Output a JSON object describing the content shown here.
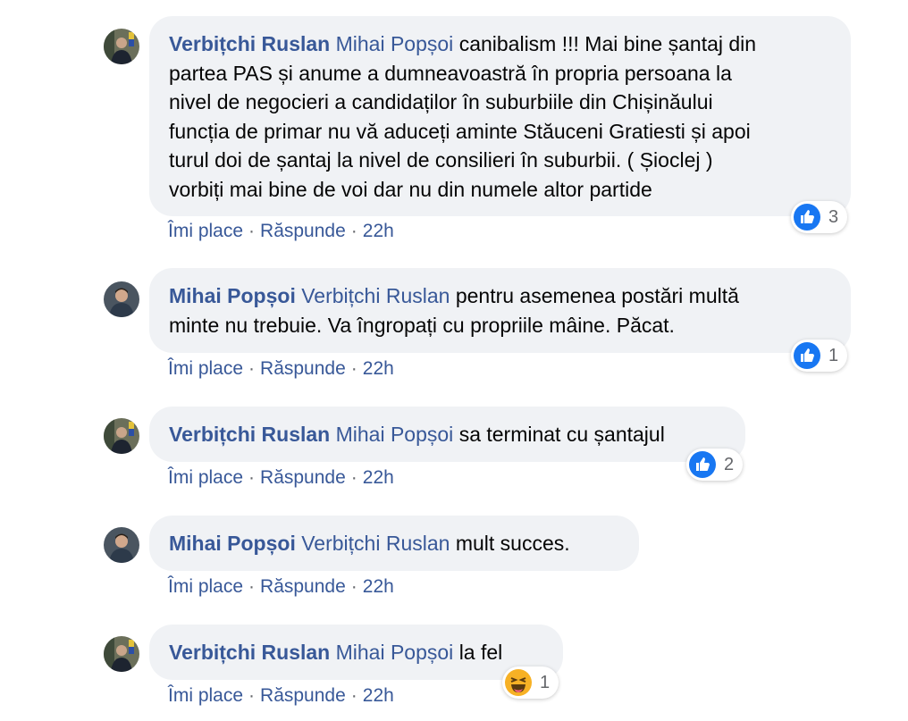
{
  "colors": {
    "link": "#385898",
    "bubble": "#f0f2f5",
    "like": "#1877f2",
    "haha": "#f7b125"
  },
  "actions": {
    "like": "Îmi place",
    "reply": "Răspunde",
    "dot": "·"
  },
  "comments": [
    {
      "author": "Verbițchi Ruslan",
      "mention": "Mihai Popșoi",
      "lines": [
        "canibalism !!! Mai bine șantaj din",
        "partea PAS și anume a dumneavoastră în propria persoana la",
        "nivel de negocieri a candidaților în suburbiile din Chișinăului",
        "funcția de primar nu vă aduceți aminte Stăuceni Gratiesti și apoi",
        "turul doi de șantaj la nivel de consilieri în suburbii. ( Șioclej )",
        "vorbiți mai bine de voi dar nu din numele altor partide"
      ],
      "time": "22h",
      "reaction": {
        "icon": "like-icon",
        "count": "3"
      }
    },
    {
      "author": "Mihai Popșoi",
      "mention": "Verbițchi Ruslan",
      "lines": [
        "pentru asemenea postări multă",
        "minte nu trebuie. Va îngropați cu propriile mâine. Păcat."
      ],
      "time": "22h",
      "reaction": {
        "icon": "like-icon",
        "count": "1"
      }
    },
    {
      "author": "Verbițchi Ruslan",
      "mention": "Mihai Popșoi",
      "lines": [
        "sa terminat cu șantajul"
      ],
      "time": "22h",
      "reaction": {
        "icon": "like-icon",
        "count": "2"
      }
    },
    {
      "author": "Mihai Popșoi",
      "mention": "Verbițchi Ruslan",
      "lines": [
        "mult succes."
      ],
      "time": "22h"
    },
    {
      "author": "Verbițchi Ruslan",
      "mention": "Mihai Popșoi",
      "lines": [
        "la fel"
      ],
      "time": "22h",
      "reaction": {
        "icon": "haha-icon",
        "count": "1"
      }
    }
  ]
}
